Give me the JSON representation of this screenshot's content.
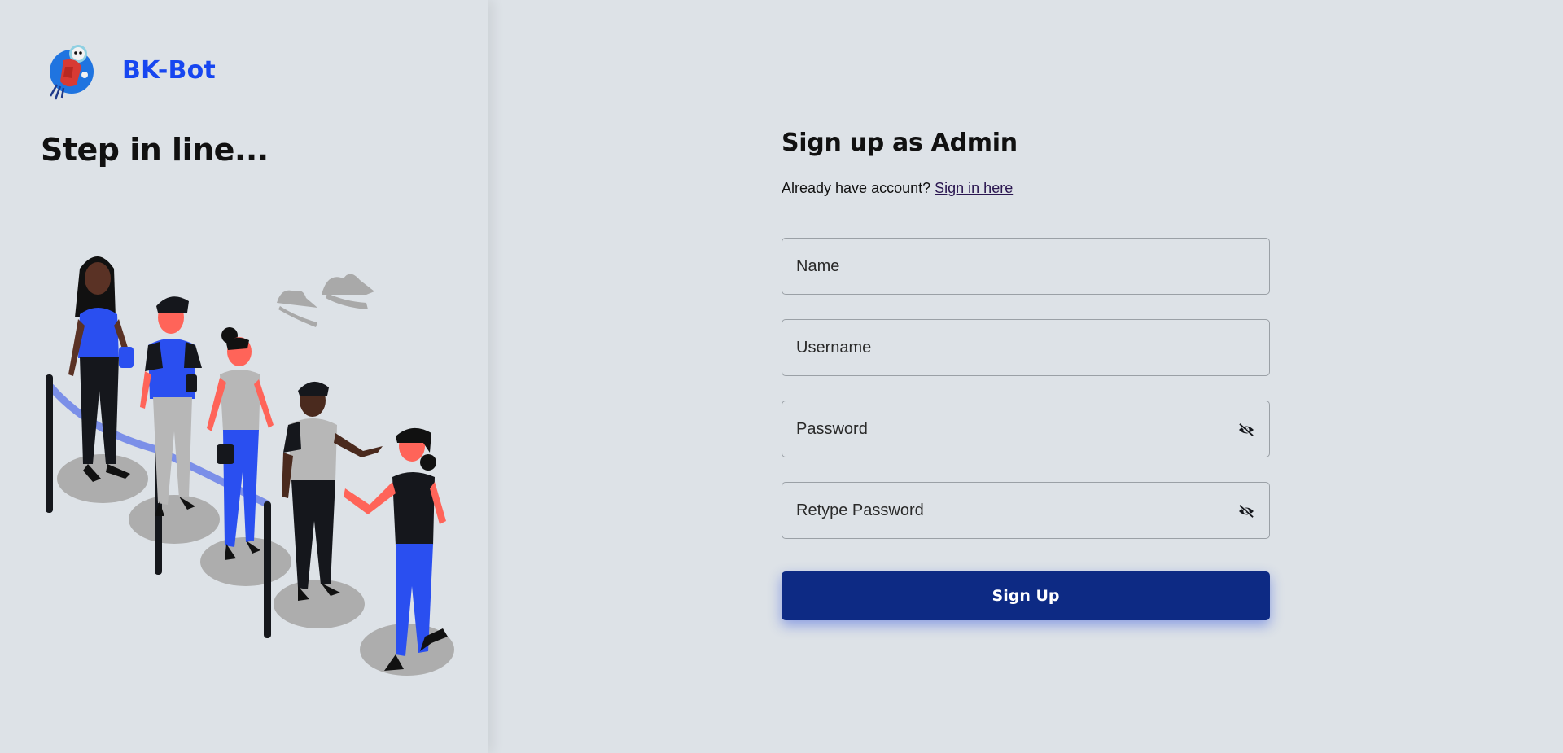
{
  "brand": {
    "name": "BK-Bot",
    "logo_icon": "robot-mascot-icon"
  },
  "tagline": "Step in line...",
  "illustration": {
    "name": "people-queue-illustration"
  },
  "form": {
    "title": "Sign up as Admin",
    "signin_prompt": "Already have account?",
    "signin_link": "Sign in here",
    "fields": {
      "name": {
        "placeholder": "Name",
        "value": ""
      },
      "username": {
        "placeholder": "Username",
        "value": ""
      },
      "password": {
        "placeholder": "Password",
        "value": "",
        "toggle_icon": "eye-slash-icon"
      },
      "retype_password": {
        "placeholder": "Retype Password",
        "value": "",
        "toggle_icon": "eye-slash-icon"
      }
    },
    "submit_label": "Sign Up"
  },
  "colors": {
    "background": "#dde2e7",
    "brand_blue": "#1746f0",
    "button_navy": "#0d2a84",
    "link": "#2a1650"
  }
}
